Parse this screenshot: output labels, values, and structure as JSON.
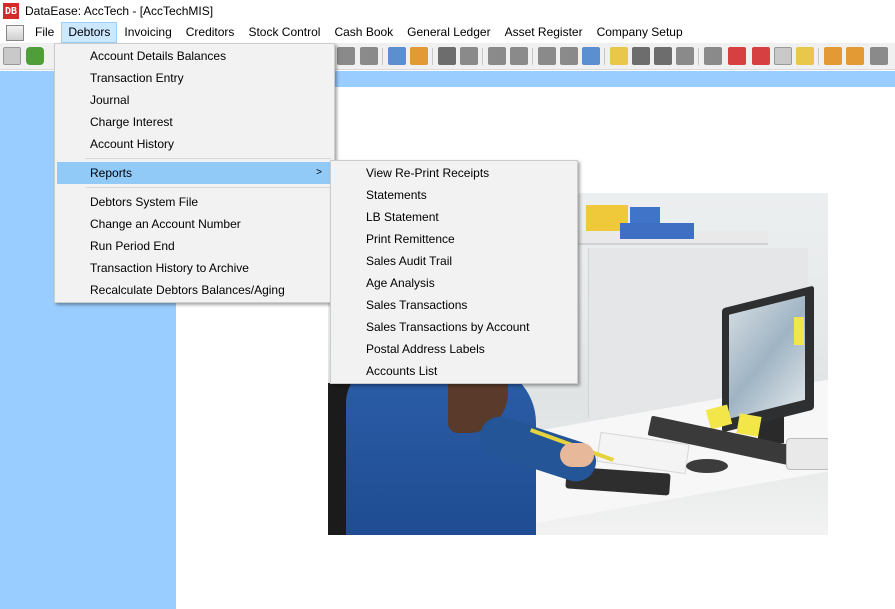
{
  "window": {
    "app_icon_text": "DB",
    "title": "DataEase: AccTech - [AccTechMIS]"
  },
  "menubar": {
    "items": [
      "File",
      "Debtors",
      "Invoicing",
      "Creditors",
      "Stock Control",
      "Cash Book",
      "General Ledger",
      "Asset Register",
      "Company Setup"
    ],
    "active": "Debtors"
  },
  "debtors_menu": {
    "items": [
      "Account Details Balances",
      "Transaction Entry",
      "Journal",
      "Charge Interest",
      "Account History",
      "Reports",
      "Debtors System File",
      "Change an Account Number",
      "Run Period End",
      "Transaction History to Archive",
      "Recalculate Debtors Balances/Aging"
    ],
    "highlighted": "Reports",
    "submenu_arrow": ">"
  },
  "reports_menu": {
    "items": [
      "View Re-Print Receipts",
      "Statements",
      "LB Statement",
      "Print Remittence",
      "Sales Audit Trail",
      "Age Analysis",
      "Sales Transactions",
      "Sales Transactions by Account",
      "Postal Address Labels",
      "Accounts List"
    ]
  },
  "colors": {
    "workspace_blue": "#99cdff",
    "menu_highlight": "#91c9f7",
    "menubar_active": "#cce8ff",
    "app_icon_red": "#d42a2a"
  },
  "icons": {
    "toolbar": [
      "chart-icon",
      "refresh-icon",
      "save-icon",
      "print-icon",
      "zoom-in-icon",
      "zoom-out-icon",
      "undo-icon",
      "redo-icon",
      "cut-icon",
      "copy-icon",
      "paste-icon",
      "import-icon",
      "export-icon"
    ]
  }
}
